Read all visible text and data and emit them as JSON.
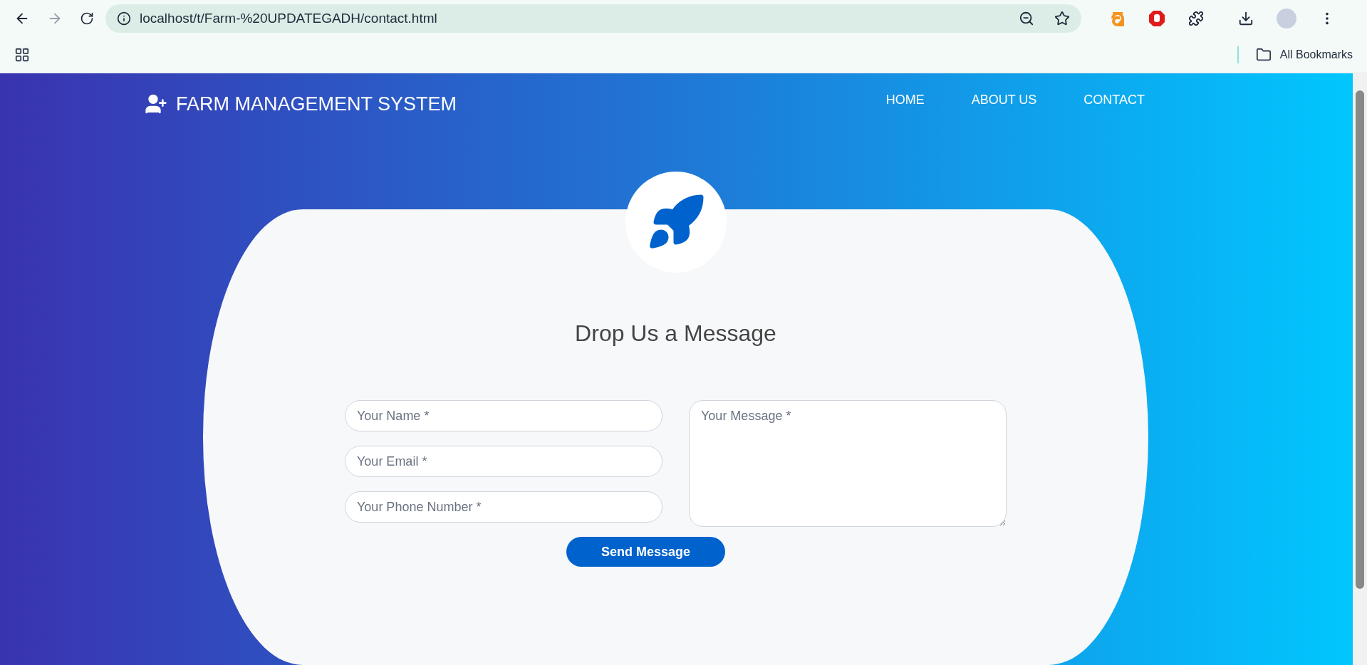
{
  "browser": {
    "url": "localhost/t/Farm-%20UPDATEGADH/contact.html",
    "back_disabled": false,
    "forward_disabled": true,
    "bookmarks_label": "All Bookmarks"
  },
  "nav": {
    "brand": "FARM MANAGEMENT SYSTEM",
    "items": [
      {
        "label": "HOME"
      },
      {
        "label": "ABOUT US"
      },
      {
        "label": "CONTACT"
      }
    ]
  },
  "form": {
    "heading": "Drop Us a Message",
    "fields": [
      {
        "placeholder": "Your Name *"
      },
      {
        "placeholder": "Your Email *"
      },
      {
        "placeholder": "Your Phone Number *"
      }
    ],
    "message": {
      "placeholder": "Your Message *"
    },
    "submit": "Send Message"
  }
}
